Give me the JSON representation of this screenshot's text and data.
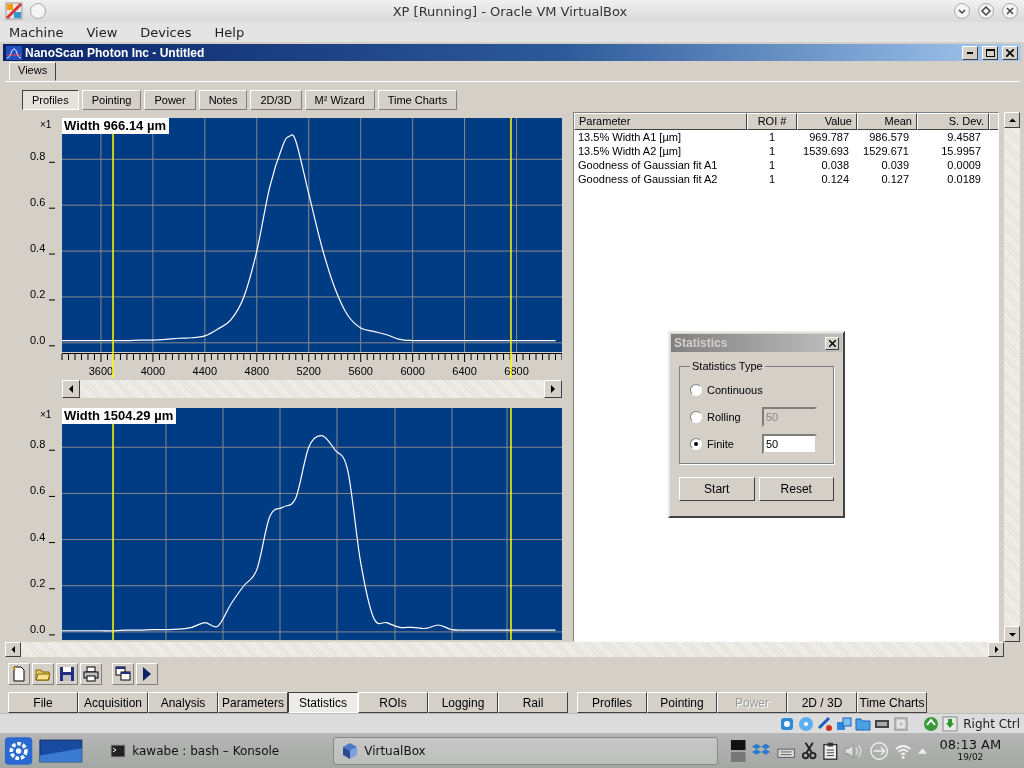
{
  "host_window": {
    "title": "XP [Running] - Oracle VM VirtualBox"
  },
  "host_menu": [
    "Machine",
    "View",
    "Devices",
    "Help"
  ],
  "app": {
    "title": "NanoScan Photon Inc - Untitled",
    "outer_tabs": [
      {
        "label": "Views",
        "selected": true
      }
    ],
    "view_tabs": [
      {
        "label": "Profiles",
        "selected": true
      },
      {
        "label": "Pointing",
        "selected": false
      },
      {
        "label": "Power",
        "selected": false
      },
      {
        "label": "Notes",
        "selected": false
      },
      {
        "label": "2D/3D",
        "selected": false
      },
      {
        "label": "M² Wizard",
        "selected": false
      },
      {
        "label": "Time Charts",
        "selected": false
      }
    ],
    "plots": [
      {
        "scale": "×1",
        "chart_data": {
          "type": "line",
          "title": "Width 966.14 µm",
          "xlim": [
            3300,
            7150
          ],
          "ylim": [
            -0.04,
            0.98
          ],
          "xticks": [
            {
              "value": 3600,
              "label": "3600"
            },
            {
              "value": 4000,
              "label": "4000"
            },
            {
              "value": 4400,
              "label": "4400"
            },
            {
              "value": 4800,
              "label": "4800"
            },
            {
              "value": 5200,
              "label": "5200"
            },
            {
              "value": 5600,
              "label": "5600"
            },
            {
              "value": 6000,
              "label": "6000"
            },
            {
              "value": 6400,
              "label": "6400"
            },
            {
              "value": 6800,
              "label": "6800"
            }
          ],
          "yticks": [
            {
              "value": 0,
              "label": "0.0"
            },
            {
              "value": 0.2,
              "label": "0.2"
            },
            {
              "value": 0.4,
              "label": "0.4"
            },
            {
              "value": 0.6,
              "label": "0.6"
            },
            {
              "value": 0.8,
              "label": "0.8"
            }
          ],
          "x": [
            3300,
            3400,
            3500,
            3600,
            3700,
            3800,
            3900,
            4000,
            4100,
            4200,
            4300,
            4400,
            4500,
            4600,
            4700,
            4800,
            4900,
            5000,
            5050,
            5100,
            5200,
            5300,
            5400,
            5500,
            5600,
            5700,
            5800,
            5900,
            6000,
            6100,
            6200,
            6300,
            6400,
            6500,
            6600,
            6700,
            6800,
            6900,
            7000,
            7100
          ],
          "values": [
            0.01,
            0.01,
            0.01,
            0.01,
            0.01,
            0.01,
            0.012,
            0.012,
            0.015,
            0.02,
            0.022,
            0.03,
            0.06,
            0.1,
            0.2,
            0.4,
            0.68,
            0.86,
            0.9,
            0.88,
            0.65,
            0.42,
            0.24,
            0.12,
            0.065,
            0.05,
            0.035,
            0.015,
            0.01,
            0.01,
            0.01,
            0.01,
            0.01,
            0.01,
            0.01,
            0.01,
            0.01,
            0.01,
            0.01,
            0.01
          ],
          "grid": true,
          "ref_lines": [
            {
              "axis": "x",
              "value": 3693,
              "color": "#ffff00"
            },
            {
              "axis": "x",
              "value": 6757,
              "color": "#ffff00"
            }
          ]
        }
      },
      {
        "scale": "×1",
        "chart_data": {
          "type": "line",
          "title": "Width 1504.29 µm",
          "xlim": [
            3300,
            7150
          ],
          "ylim": [
            -0.035,
            0.97
          ],
          "yticks": [
            {
              "value": 0,
              "label": "0.0"
            },
            {
              "value": 0.2,
              "label": "0.2"
            },
            {
              "value": 0.4,
              "label": "0.4"
            },
            {
              "value": 0.6,
              "label": "0.6"
            },
            {
              "value": 0.8,
              "label": "0.8"
            }
          ],
          "x": [
            3300,
            3400,
            3500,
            3600,
            3700,
            3800,
            3900,
            4000,
            4100,
            4200,
            4300,
            4400,
            4500,
            4600,
            4700,
            4800,
            4900,
            5000,
            5100,
            5200,
            5300,
            5400,
            5500,
            5600,
            5700,
            5800,
            5900,
            6000,
            6100,
            6200,
            6300,
            6400,
            6500,
            6600,
            6700,
            6800,
            6900,
            7000,
            7100
          ],
          "values": [
            0.005,
            0.005,
            0.005,
            0.005,
            0.005,
            0.008,
            0.008,
            0.01,
            0.01,
            0.012,
            0.02,
            0.04,
            0.025,
            0.12,
            0.2,
            0.27,
            0.5,
            0.54,
            0.58,
            0.8,
            0.85,
            0.79,
            0.7,
            0.3,
            0.06,
            0.04,
            0.02,
            0.02,
            0.015,
            0.03,
            0.01,
            0.008,
            0.008,
            0.008,
            0.008,
            0.008,
            0.008,
            0.008,
            0.008
          ],
          "grid": true,
          "ref_lines": [
            {
              "axis": "x",
              "value": 3693,
              "color": "#ffff00"
            },
            {
              "axis": "x",
              "value": 6757,
              "color": "#ffff00"
            }
          ]
        }
      }
    ],
    "table": {
      "columns": [
        "Parameter",
        "ROI #",
        "Value",
        "Mean",
        "S. Dev."
      ],
      "rows": [
        [
          "13.5% Width A1 [µm]",
          "1",
          "969.787",
          "986.579",
          "9.4587"
        ],
        [
          "13.5% Width A2 [µm]",
          "1",
          "1539.693",
          "1529.671",
          "15.9957"
        ],
        [
          "Goodness of Gaussian fit A1",
          "1",
          "0.038",
          "0.039",
          "0.0009"
        ],
        [
          "Goodness of Gaussian fit A2",
          "1",
          "0.124",
          "0.127",
          "0.0189"
        ]
      ]
    },
    "function_tabs": [
      {
        "label": "File",
        "selected": false
      },
      {
        "label": "Acquisition",
        "selected": false
      },
      {
        "label": "Analysis",
        "selected": false
      },
      {
        "label": "Parameters",
        "selected": false
      },
      {
        "label": "Statistics",
        "selected": true
      },
      {
        "label": "ROIs",
        "selected": false
      },
      {
        "label": "Logging",
        "selected": false
      },
      {
        "label": "Rail",
        "selected": false
      }
    ],
    "view_switch_tabs": [
      {
        "label": "Profiles",
        "disabled": false
      },
      {
        "label": "Pointing",
        "disabled": false
      },
      {
        "label": "Power",
        "disabled": true
      },
      {
        "label": "2D / 3D",
        "disabled": false
      },
      {
        "label": "Time Charts",
        "disabled": false
      }
    ]
  },
  "statistics_dialog": {
    "title": "Statistics",
    "group": "Statistics Type",
    "options": [
      {
        "label": "Continuous",
        "selected": false
      },
      {
        "label": "Rolling",
        "selected": false,
        "value": "50",
        "value_disabled": true
      },
      {
        "label": "Finite",
        "selected": true,
        "value": "50",
        "value_disabled": false
      }
    ],
    "buttons": [
      "Start",
      "Reset"
    ]
  },
  "vm_status": {
    "host_key": "Right Ctrl"
  },
  "taskbar": {
    "tasks": [
      {
        "label": "kawabe : bash – Konsole",
        "selected": false
      },
      {
        "label": "VirtualBox",
        "selected": true
      }
    ],
    "clock": {
      "time": "08:13 AM",
      "date": "19/02"
    }
  }
}
